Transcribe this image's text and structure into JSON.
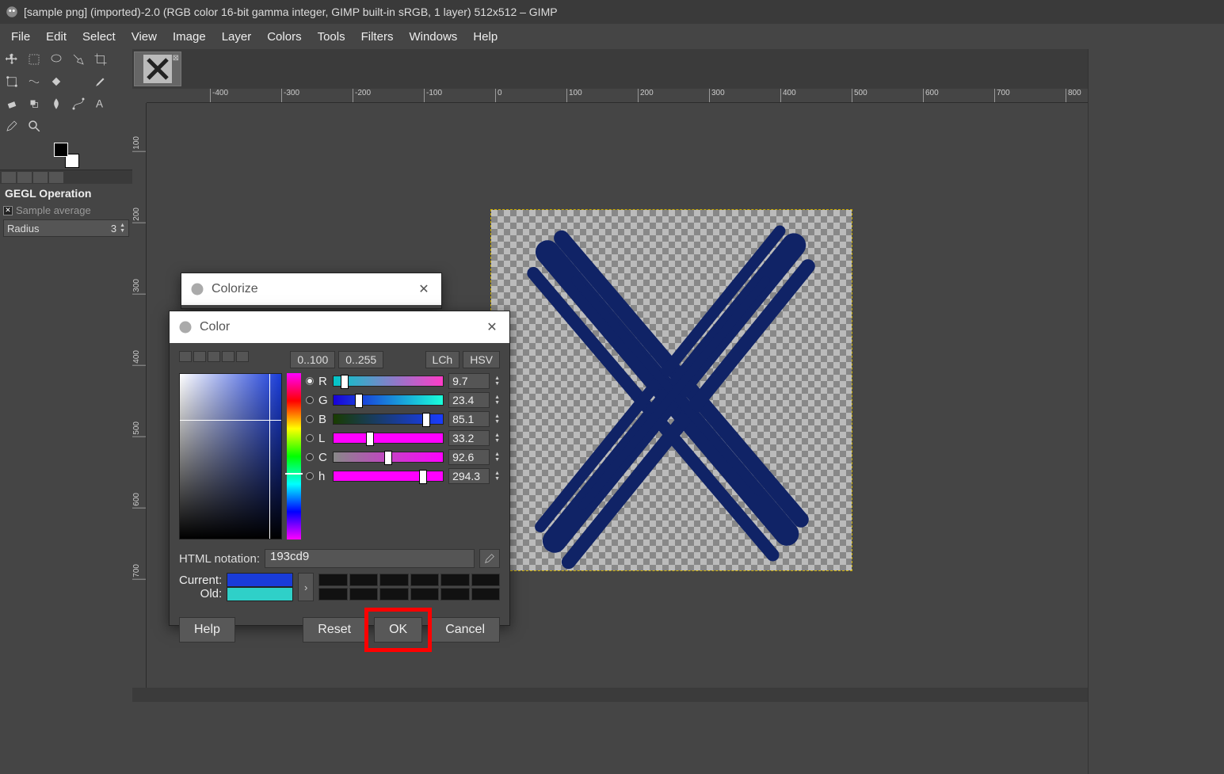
{
  "window": {
    "title": "[sample png] (imported)-2.0 (RGB color 16-bit gamma integer, GIMP built-in sRGB, 1 layer) 512x512 – GIMP"
  },
  "menu": {
    "items": [
      "File",
      "Edit",
      "Select",
      "View",
      "Image",
      "Layer",
      "Colors",
      "Tools",
      "Filters",
      "Windows",
      "Help"
    ]
  },
  "tool_options": {
    "title": "GEGL Operation",
    "sample_average": "Sample average",
    "radius_label": "Radius",
    "radius_value": "3"
  },
  "ruler_h": [
    "-400",
    "-300",
    "-200",
    "-100",
    "0",
    "100",
    "200",
    "300",
    "400",
    "500",
    "600",
    "700",
    "800"
  ],
  "ruler_v": [
    "100",
    "200",
    "300",
    "400",
    "500",
    "600",
    "700"
  ],
  "canvas": {
    "brush_color": "#102366"
  },
  "colorize_dialog": {
    "title": "Colorize"
  },
  "color_dialog": {
    "title": "Color",
    "scale0": "0..100",
    "scale1": "0..255",
    "mode_lch": "LCh",
    "mode_hsv": "HSV",
    "channels": [
      {
        "label": "R",
        "value": "9.7",
        "pos": 10,
        "grad": "linear-gradient(to right,#00c8c8,#ff3cc8)",
        "thumb": "#7a3cc8"
      },
      {
        "label": "G",
        "value": "23.4",
        "pos": 23,
        "grad": "linear-gradient(to right,#1900d9,#19ffd9)",
        "thumb": "#1960d9"
      },
      {
        "label": "B",
        "value": "85.1",
        "pos": 85,
        "grad": "linear-gradient(to right,#193c00,#193cff)",
        "thumb": "#193cc0"
      },
      {
        "label": "L",
        "value": "33.2",
        "pos": 33,
        "grad": "linear-gradient(to right,#f0f,#f0f)",
        "thumb": "#fff"
      },
      {
        "label": "C",
        "value": "92.6",
        "pos": 50,
        "grad": "linear-gradient(to right,#888,#f0f)",
        "thumb": "#fff"
      },
      {
        "label": "h",
        "value": "294.3",
        "pos": 82,
        "grad": "linear-gradient(to right,#f0f,#f0f)",
        "thumb": "#fff"
      }
    ],
    "html_label": "HTML notation:",
    "html_value": "193cd9",
    "current_label": "Current:",
    "old_label": "Old:",
    "buttons": {
      "help": "Help",
      "reset": "Reset",
      "ok": "OK",
      "cancel": "Cancel"
    }
  }
}
